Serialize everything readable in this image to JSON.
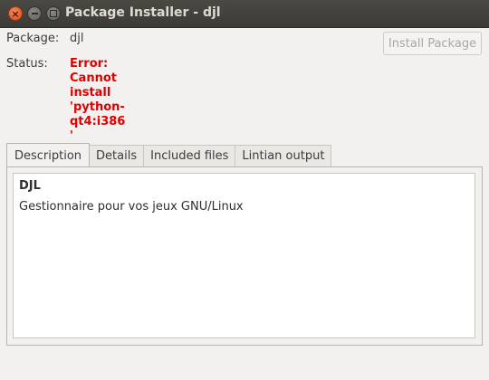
{
  "window": {
    "title": "Package Installer - djl"
  },
  "fields": {
    "package_label": "Package:",
    "package_value": "djl",
    "status_label": "Status:",
    "status_value": "Error: Cannot install 'python-qt4:i386'"
  },
  "install_button": {
    "label": "Install Package",
    "enabled": false
  },
  "tabs": [
    {
      "label": "Description",
      "active": true
    },
    {
      "label": "Details",
      "active": false
    },
    {
      "label": "Included files",
      "active": false
    },
    {
      "label": "Lintian output",
      "active": false
    }
  ],
  "description": {
    "title": "DJL",
    "text": "Gestionnaire pour vos jeux GNU/Linux"
  },
  "colors": {
    "titlebar": "#3c3b37",
    "error": "#e00000",
    "close_button": "#df4a16",
    "window_bg": "#f2f1f0"
  },
  "icons": {
    "close": "close-icon",
    "minimize": "minimize-icon",
    "maximize": "maximize-icon"
  }
}
